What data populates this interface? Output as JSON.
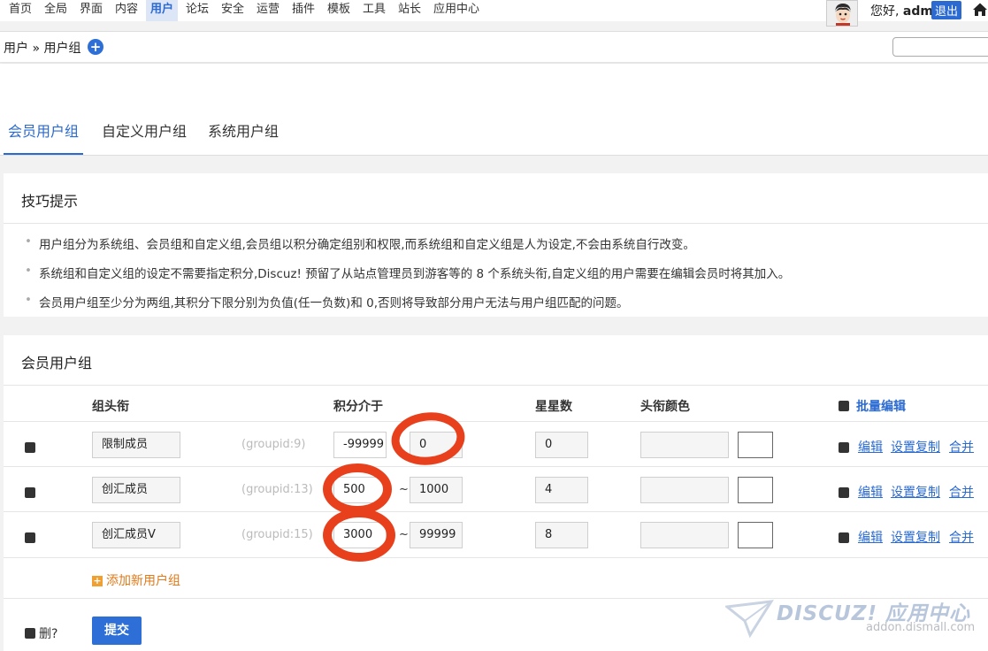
{
  "topnav": {
    "items": [
      "首页",
      "全局",
      "界面",
      "内容",
      "用户",
      "论坛",
      "安全",
      "运营",
      "插件",
      "模板",
      "工具",
      "站长",
      "应用中心"
    ],
    "active_index": 4,
    "greeting": "您好,",
    "username": "adm",
    "logout": "退出"
  },
  "breadcrumb": {
    "text": "用户 » 用户组",
    "plus": "+"
  },
  "tabs": [
    "会员用户组",
    "自定义用户组",
    "系统用户组"
  ],
  "tips": {
    "title": "技巧提示",
    "items": [
      "用户组分为系统组、会员组和自定义组,会员组以积分确定组别和权限,而系统组和自定义组是人为设定,不会由系统自行改变。",
      "系统组和自定义组的设定不需要指定积分,Discuz! 预留了从站点管理员到游客等的 8 个系统头衔,自定义组的用户需要在编辑会员时将其加入。",
      "会员用户组至少分为两组,其积分下限分别为负值(任一负数)和 0,否则将导致部分用户无法与用户组匹配的问题。"
    ]
  },
  "groups": {
    "title": "会员用户组",
    "headers": {
      "title": "组头衔",
      "credits": "积分介于",
      "stars": "星星数",
      "color": "头衔颜色",
      "batch": "批量编辑"
    },
    "rows": [
      {
        "name": "限制成员",
        "groupid": "(groupid:9)",
        "low": "-99999",
        "high": "0",
        "stars": "0"
      },
      {
        "name": "创汇成员",
        "groupid": "(groupid:13)",
        "low": "500",
        "high": "1000",
        "stars": "4"
      },
      {
        "name": "创汇成员V",
        "groupid": "(groupid:15)",
        "low": "3000",
        "high": "99999",
        "stars": "8"
      }
    ],
    "tilde": "~",
    "actions": {
      "edit": "编辑",
      "copy": "设置复制",
      "merge": "合并"
    },
    "add_group": "添加新用户组",
    "delete_label": "删?",
    "submit": "提交"
  },
  "watermark": {
    "brand": "DISCUZ! 应用中心",
    "url": "addon.dismall.com"
  },
  "colors": {
    "accent": "#2a6ad1",
    "annotation": "#e8401c",
    "add_link": "#e07a1a"
  }
}
